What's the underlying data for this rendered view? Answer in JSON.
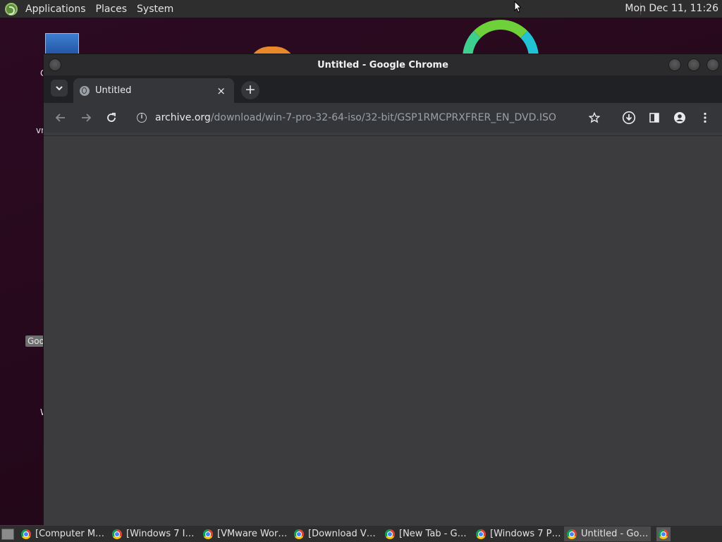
{
  "top_panel": {
    "menus": [
      "Applications",
      "Places",
      "System"
    ],
    "clock": "Mon Dec 11, 11:26"
  },
  "desktop": {
    "labels": [
      "C",
      "vn",
      "Goo",
      "W"
    ]
  },
  "window": {
    "title": "Untitled - Google Chrome",
    "tab": {
      "title": "Untitled",
      "close": "×"
    },
    "new_tab": "+",
    "url_host": "archive.org",
    "url_path": "/download/win-7-pro-32-64-iso/32-bit/GSP1RMCPRXFRER_EN_DVD.ISO"
  },
  "taskbar": {
    "tasks": [
      "[Computer M…",
      "[Windows 7 I…",
      "[VMware Wor…",
      "[Download V…",
      "[New Tab - G…",
      "[Windows 7 P…",
      "Untitled - Go…"
    ]
  },
  "colors": {
    "desktop_bg": "#2a0a1e",
    "panel_bg": "#2e2e2e",
    "chrome_frame": "#202124",
    "chrome_toolbar": "#35363a",
    "content_bg": "#3c3c3e"
  }
}
